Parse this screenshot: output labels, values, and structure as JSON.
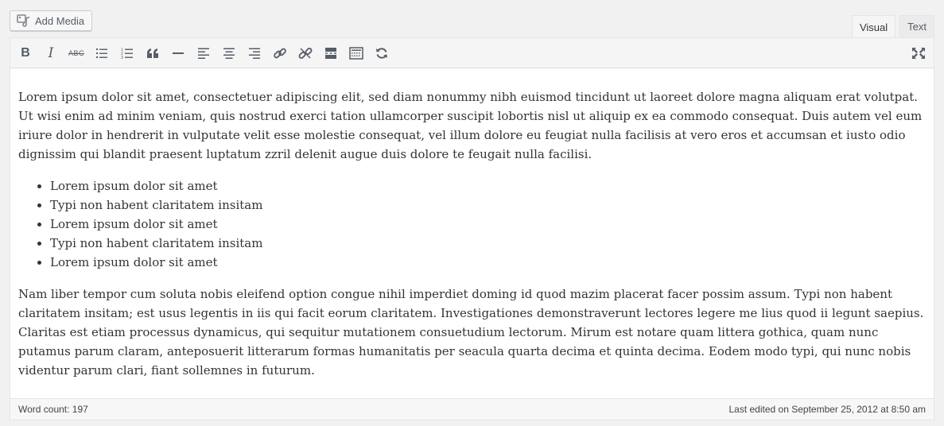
{
  "add_media": {
    "label": "Add Media",
    "icon": "media-icon"
  },
  "tabs": [
    {
      "label": "Visual",
      "active": true
    },
    {
      "label": "Text",
      "active": false
    }
  ],
  "toolbar": {
    "buttons": [
      {
        "name": "bold",
        "icon": "bold-icon",
        "glyph": "B"
      },
      {
        "name": "italic",
        "icon": "italic-icon",
        "glyph": "I"
      },
      {
        "name": "strikethrough",
        "icon": "strikethrough-icon",
        "glyph": "ABC"
      },
      {
        "name": "bulleted-list",
        "icon": "bulleted-list-icon"
      },
      {
        "name": "numbered-list",
        "icon": "numbered-list-icon"
      },
      {
        "name": "blockquote",
        "icon": "blockquote-icon",
        "glyph": "“"
      },
      {
        "name": "horizontal-line",
        "icon": "horizontal-line-icon"
      },
      {
        "name": "align-left",
        "icon": "align-left-icon"
      },
      {
        "name": "align-center",
        "icon": "align-center-icon"
      },
      {
        "name": "align-right",
        "icon": "align-right-icon"
      },
      {
        "name": "insert-link",
        "icon": "link-icon"
      },
      {
        "name": "remove-link",
        "icon": "unlink-icon"
      },
      {
        "name": "read-more",
        "icon": "read-more-icon"
      },
      {
        "name": "toolbar-toggle",
        "icon": "keyboard-icon"
      },
      {
        "name": "refresh",
        "icon": "refresh-icon"
      }
    ],
    "fullscreen_icon": "fullscreen-icon"
  },
  "content": {
    "paragraph1": "Lorem ipsum dolor sit amet, consectetuer adipiscing elit, sed diam nonummy nibh euismod tincidunt ut laoreet dolore magna aliquam erat volutpat. Ut wisi enim ad minim veniam, quis nostrud exerci tation ullamcorper suscipit lobortis nisl ut aliquip ex ea commodo consequat. Duis autem vel eum iriure dolor in hendrerit in vulputate velit esse molestie consequat, vel illum dolore eu feugiat nulla facilisis at vero eros et accumsan et iusto odio dignissim qui blandit praesent luptatum zzril delenit augue duis dolore te feugait nulla facilisi.",
    "list": [
      "Lorem ipsum dolor sit amet",
      "Typi non habent claritatem insitam",
      "Lorem ipsum dolor sit amet",
      "Typi non habent claritatem insitam",
      "Lorem ipsum dolor sit amet"
    ],
    "paragraph2": "Nam liber tempor cum soluta nobis eleifend option congue nihil imperdiet doming id quod mazim placerat facer possim assum. Typi non habent claritatem insitam; est usus legentis in iis qui facit eorum claritatem. Investigationes demonstraverunt lectores legere me lius quod ii legunt saepius. Claritas est etiam processus dynamicus, qui sequitur mutationem consuetudium lectorum. Mirum est notare quam littera gothica, quam nunc putamus parum claram, anteposuerit litterarum formas humanitatis per seacula quarta decima et quinta decima. Eodem modo typi, qui nunc nobis videntur parum clari, fiant sollemnes in futurum."
  },
  "status": {
    "word_count": "Word count: 197",
    "last_edited": "Last edited on September 25, 2012 at 8:50 am"
  }
}
